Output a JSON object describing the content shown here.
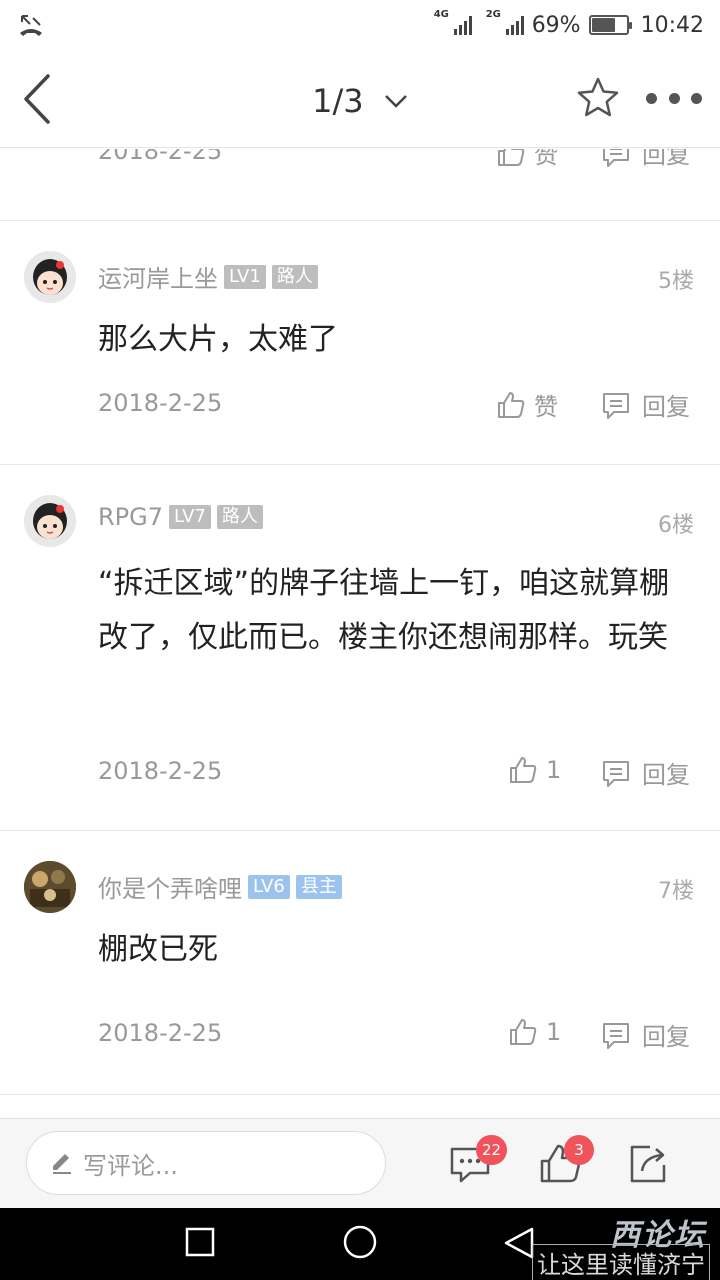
{
  "status_bar": {
    "network_1": "4G",
    "network_2": "2G",
    "battery": "69%",
    "battery_level": 0.69,
    "time": "10:42"
  },
  "nav": {
    "page_indicator": "1/3"
  },
  "comments": [
    {
      "date": "2018-2-25",
      "like_label": "赞",
      "reply_label": "回复"
    },
    {
      "username": "运河岸上坐",
      "level": "LV1",
      "title_badge": "路人",
      "floor": "5楼",
      "content": "那么大片，太难了",
      "date": "2018-2-25",
      "like_label": "赞",
      "reply_label": "回复"
    },
    {
      "username": "RPG7",
      "level": "LV7",
      "title_badge": "路人",
      "floor": "6楼",
      "content": "“拆迁区域”的牌子往墙上一钉，咱这就算棚改了，仅此而已。楼主你还想闹那样。玩笑",
      "date": "2018-2-25",
      "like_label": "1",
      "reply_label": "回复"
    },
    {
      "username": "你是个弄啥哩",
      "level": "LV6",
      "title_badge": "县主",
      "floor": "7楼",
      "content": "棚改已死",
      "date": "2018-2-25",
      "like_label": "1",
      "reply_label": "回复"
    }
  ],
  "bottom_bar": {
    "comment_placeholder": "写评论...",
    "comment_count": "22",
    "like_count": "3"
  },
  "watermark": {
    "line1": "西论坛",
    "line2": "让这里读懂济宁"
  },
  "colors": {
    "badge_gray": "#bdbdbd",
    "badge_blue": "#9cc3ee",
    "notification_red": "#f0535a"
  }
}
